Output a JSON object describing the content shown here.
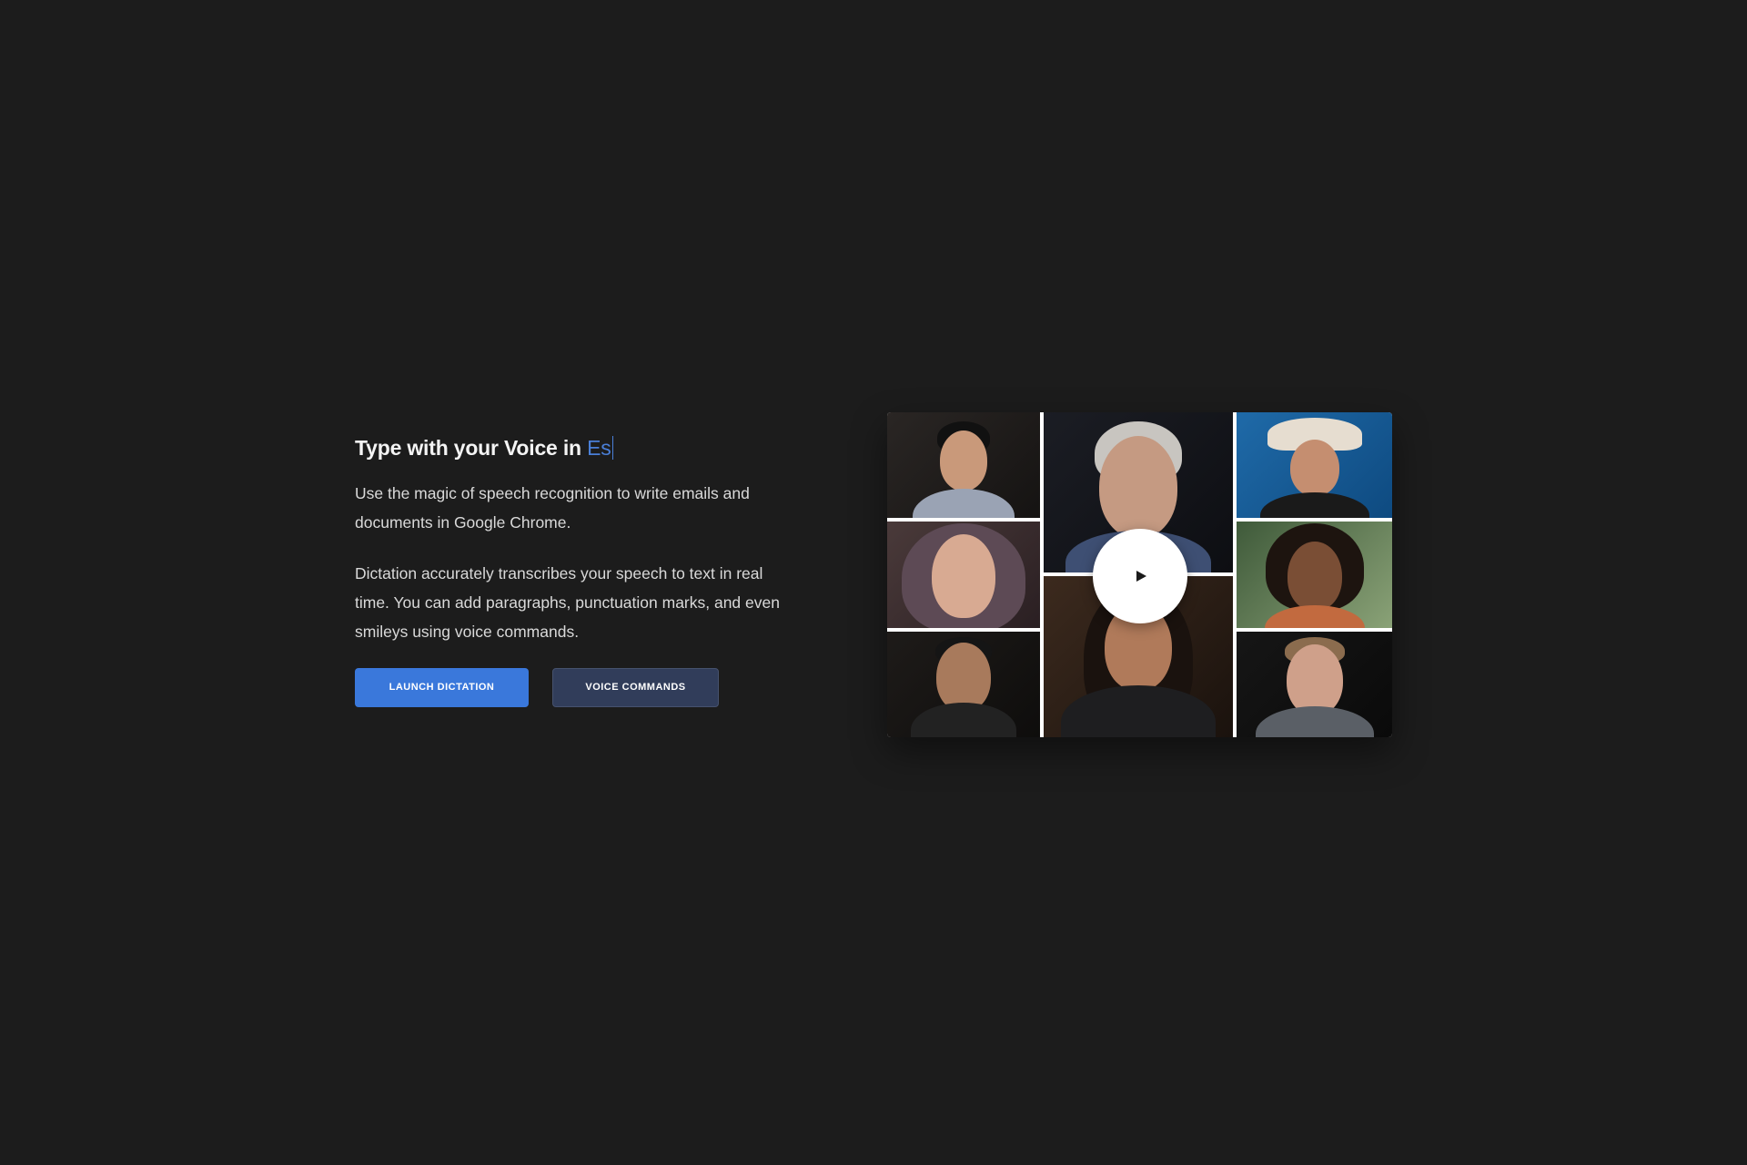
{
  "hero": {
    "headline_prefix": "Type with your Voice in",
    "headline_language": "Es",
    "paragraph_1": "Use the magic of speech recognition to write emails and documents in Google Chrome.",
    "paragraph_2": "Dictation accurately transcribes your speech to text in real time. You can add paragraphs, punctuation marks, and even smileys using voice commands.",
    "launch_button_label": "LAUNCH DICTATION",
    "commands_button_label": "VOICE COMMANDS"
  },
  "video": {
    "play_icon": "play-icon"
  },
  "colors": {
    "background": "#1c1c1c",
    "accent": "#3a78db",
    "secondary_button": "#313d5a",
    "headline_language": "#4a7fd8"
  }
}
